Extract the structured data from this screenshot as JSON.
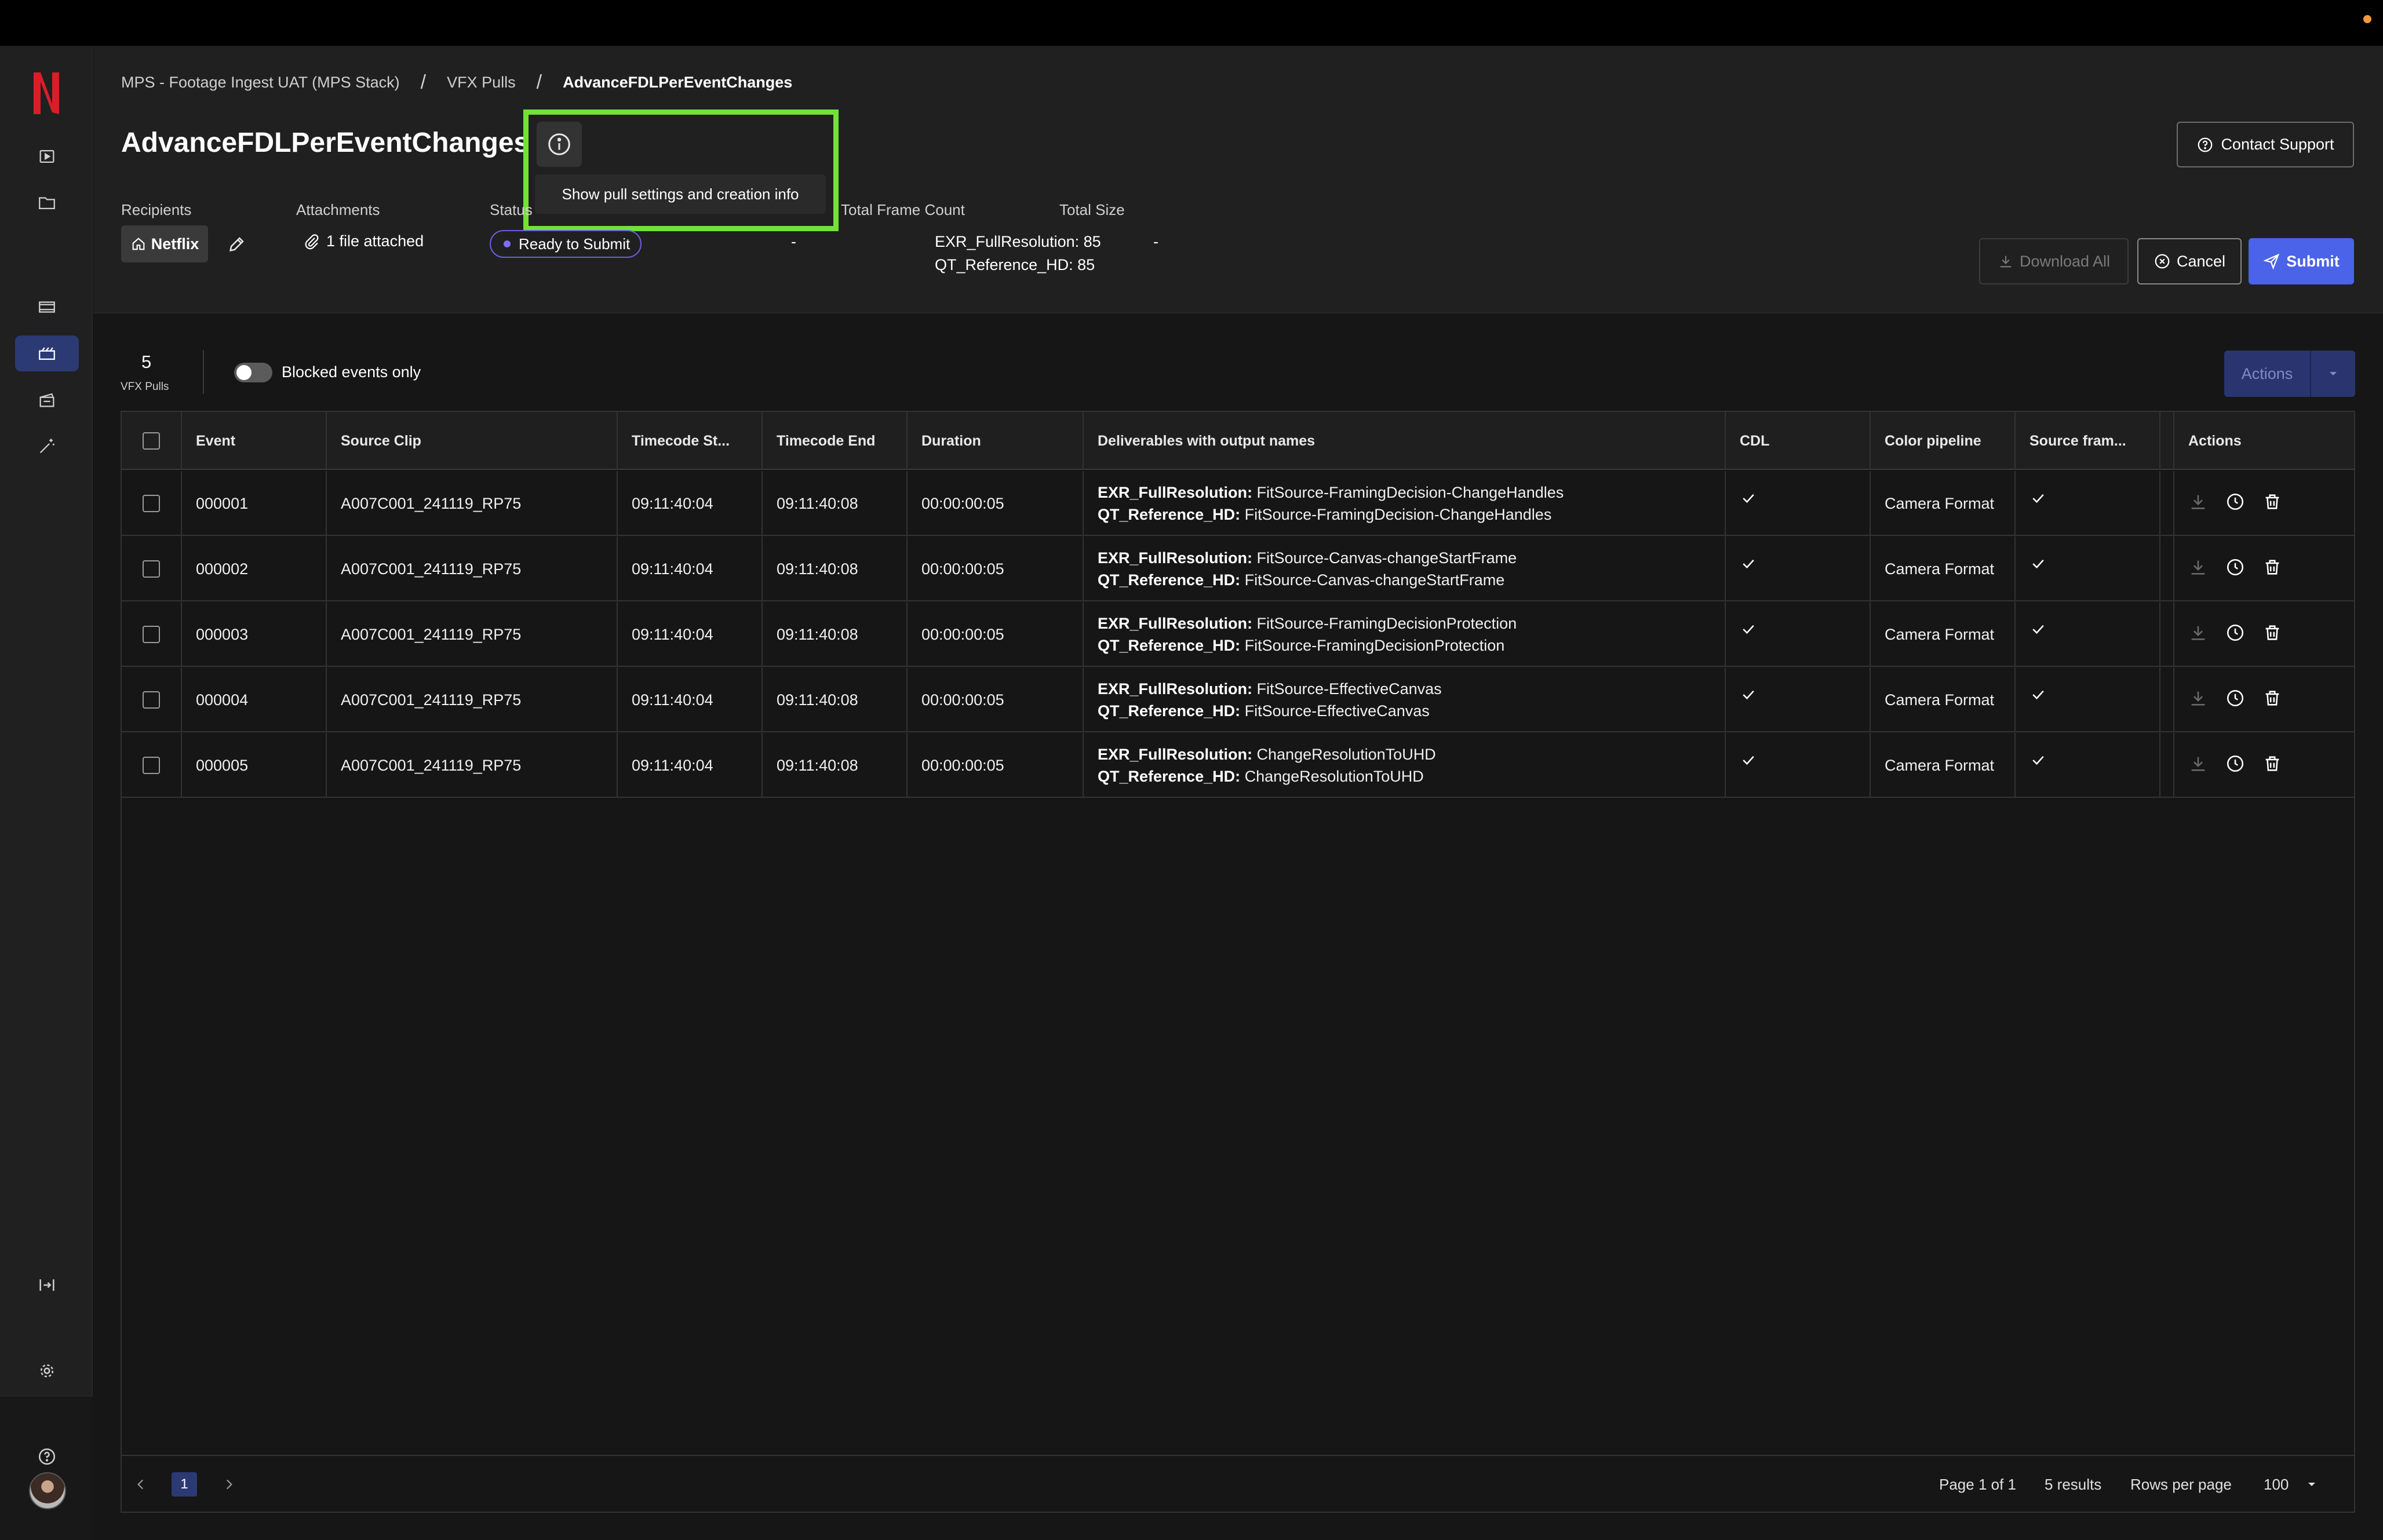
{
  "breadcrumb": [
    "MPS - Footage Ingest UAT (MPS Stack)",
    "VFX Pulls",
    "AdvanceFDLPerEventChanges"
  ],
  "title": "AdvanceFDLPerEventChanges",
  "tooltip": "Show pull settings and creation info",
  "contact_support": "Contact Support",
  "meta": {
    "recipients_label": "Recipients",
    "recipient": "Netflix",
    "attachments_label": "Attachments",
    "attachments_value": "1 file attached",
    "status_label": "Status",
    "status_value": "Ready to Submit",
    "dash1": "-",
    "frame_count_label": "Total Frame Count",
    "frame_count_lines": [
      "EXR_FullResolution: 85",
      "QT_Reference_HD: 85"
    ],
    "total_size_label": "Total Size",
    "total_size_value": "-"
  },
  "buttons": {
    "download_all": "Download All",
    "cancel": "Cancel",
    "submit": "Submit",
    "actions": "Actions"
  },
  "summary": {
    "count": "5",
    "count_label": "VFX Pulls",
    "toggle_label": "Blocked events only"
  },
  "columns": [
    "Event",
    "Source Clip",
    "Timecode St...",
    "Timecode End",
    "Duration",
    "Deliverables with output names",
    "CDL",
    "Color pipeline",
    "Source fram...",
    "Actions"
  ],
  "rows": [
    {
      "event": "000001",
      "clip": "A007C001_241119_RP75",
      "tc_start": "09:11:40:04",
      "tc_end": "09:11:40:08",
      "duration": "00:00:00:05",
      "d1_key": "EXR_FullResolution:",
      "d1_val": " FitSource-FramingDecision-ChangeHandles",
      "d2_key": "QT_Reference_HD:",
      "d2_val": " FitSource-FramingDecision-ChangeHandles",
      "pipeline": "Camera Format"
    },
    {
      "event": "000002",
      "clip": "A007C001_241119_RP75",
      "tc_start": "09:11:40:04",
      "tc_end": "09:11:40:08",
      "duration": "00:00:00:05",
      "d1_key": "EXR_FullResolution:",
      "d1_val": " FitSource-Canvas-changeStartFrame",
      "d2_key": "QT_Reference_HD:",
      "d2_val": " FitSource-Canvas-changeStartFrame",
      "pipeline": "Camera Format"
    },
    {
      "event": "000003",
      "clip": "A007C001_241119_RP75",
      "tc_start": "09:11:40:04",
      "tc_end": "09:11:40:08",
      "duration": "00:00:00:05",
      "d1_key": "EXR_FullResolution:",
      "d1_val": " FitSource-FramingDecisionProtection",
      "d2_key": "QT_Reference_HD:",
      "d2_val": " FitSource-FramingDecisionProtection",
      "pipeline": "Camera Format"
    },
    {
      "event": "000004",
      "clip": "A007C001_241119_RP75",
      "tc_start": "09:11:40:04",
      "tc_end": "09:11:40:08",
      "duration": "00:00:00:05",
      "d1_key": "EXR_FullResolution:",
      "d1_val": " FitSource-EffectiveCanvas",
      "d2_key": "QT_Reference_HD:",
      "d2_val": " FitSource-EffectiveCanvas",
      "pipeline": "Camera Format"
    },
    {
      "event": "000005",
      "clip": "A007C001_241119_RP75",
      "tc_start": "09:11:40:04",
      "tc_end": "09:11:40:08",
      "duration": "00:00:00:05",
      "d1_key": "EXR_FullResolution:",
      "d1_val": " ChangeResolutionToUHD",
      "d2_key": "QT_Reference_HD:",
      "d2_val": " ChangeResolutionToUHD",
      "pipeline": "Camera Format"
    }
  ],
  "pagination": {
    "current_page": "1",
    "page_info": "Page 1 of 1",
    "results": "5 results",
    "rows_per_page_label": "Rows per page",
    "rows_per_page": "100"
  },
  "colors": {
    "accent": "#4a63e8",
    "highlight": "#73e13a",
    "sidebar_active": "#2b3a73",
    "status_dot": "#7d6ff5"
  }
}
